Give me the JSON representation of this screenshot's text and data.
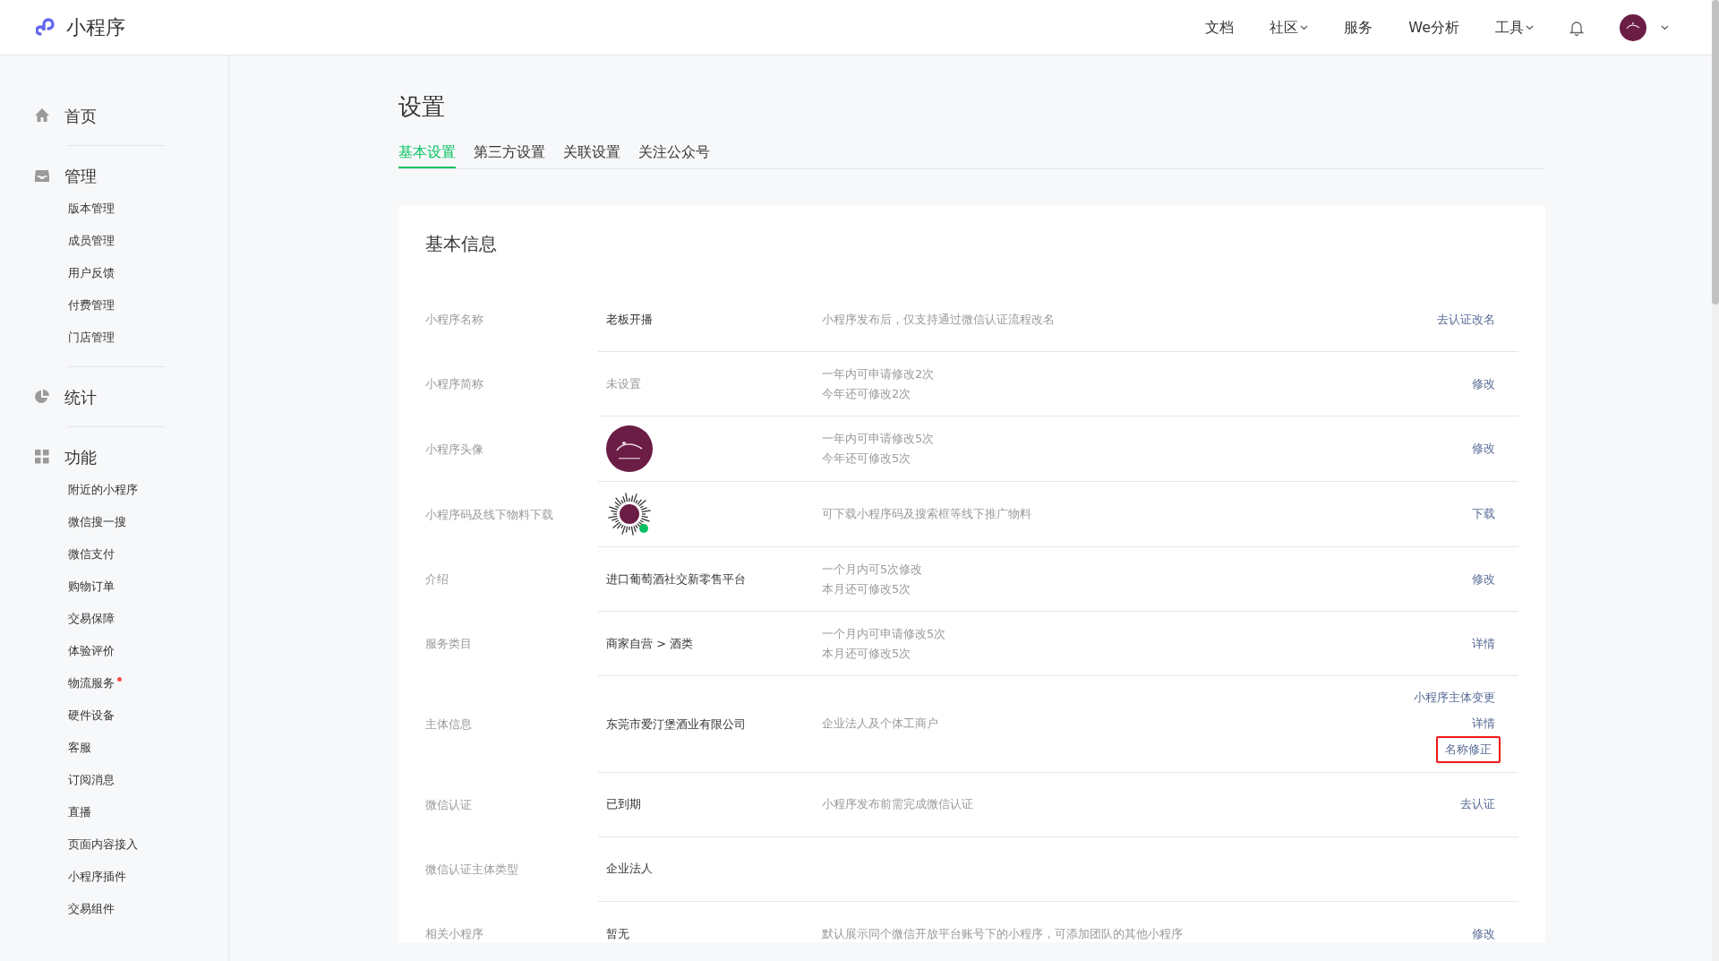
{
  "header": {
    "brand": "小程序",
    "nav": [
      {
        "label": "文档",
        "dropdown": false
      },
      {
        "label": "社区",
        "dropdown": true
      },
      {
        "label": "服务",
        "dropdown": false
      },
      {
        "label": "We分析",
        "dropdown": false
      },
      {
        "label": "工具",
        "dropdown": true
      }
    ]
  },
  "sidebar": {
    "sections": [
      {
        "title": "首页"
      },
      {
        "title": "管理",
        "items": [
          {
            "label": "版本管理",
            "dot": false
          },
          {
            "label": "成员管理",
            "dot": false
          },
          {
            "label": "用户反馈",
            "dot": false
          },
          {
            "label": "付费管理",
            "dot": false
          },
          {
            "label": "门店管理",
            "dot": false
          }
        ]
      },
      {
        "title": "统计"
      },
      {
        "title": "功能",
        "items": [
          {
            "label": "附近的小程序",
            "dot": false
          },
          {
            "label": "微信搜一搜",
            "dot": false
          },
          {
            "label": "微信支付",
            "dot": false
          },
          {
            "label": "购物订单",
            "dot": false
          },
          {
            "label": "交易保障",
            "dot": false
          },
          {
            "label": "体验评价",
            "dot": false
          },
          {
            "label": "物流服务",
            "dot": true
          },
          {
            "label": "硬件设备",
            "dot": false
          },
          {
            "label": "客服",
            "dot": false
          },
          {
            "label": "订阅消息",
            "dot": false
          },
          {
            "label": "直播",
            "dot": false
          },
          {
            "label": "页面内容接入",
            "dot": false
          },
          {
            "label": "小程序插件",
            "dot": false
          },
          {
            "label": "交易组件",
            "dot": false
          }
        ]
      }
    ]
  },
  "page": {
    "title": "设置",
    "tabs": [
      {
        "label": "基本设置",
        "selected": true
      },
      {
        "label": "第三方设置",
        "selected": false
      },
      {
        "label": "关联设置",
        "selected": false
      },
      {
        "label": "关注公众号",
        "selected": false
      }
    ]
  },
  "card": {
    "title": "基本信息",
    "rows": [
      {
        "label": "小程序名称",
        "kind": "text",
        "value": "老板开播",
        "muted": false,
        "notes": [
          "小程序发布后，仅支持通过微信认证流程改名"
        ],
        "actions": [
          {
            "label": "去认证改名",
            "highlighted": false
          }
        ]
      },
      {
        "label": "小程序简称",
        "kind": "text",
        "value": "未设置",
        "muted": true,
        "notes": [
          "一年内可申请修改2次",
          "今年还可修改2次"
        ],
        "actions": [
          {
            "label": "修改",
            "highlighted": false
          }
        ]
      },
      {
        "label": "小程序头像",
        "kind": "avatar",
        "notes": [
          "一年内可申请修改5次",
          "今年还可修改5次"
        ],
        "actions": [
          {
            "label": "修改",
            "highlighted": false
          }
        ]
      },
      {
        "label": "小程序码及线下物料下载",
        "kind": "qrcode",
        "notes": [
          "可下载小程序码及搜索框等线下推广物料"
        ],
        "actions": [
          {
            "label": "下载",
            "highlighted": false
          }
        ]
      },
      {
        "label": "介绍",
        "kind": "text",
        "value": "进口葡萄酒社交新零售平台",
        "muted": false,
        "notes": [
          "一个月内可5次修改",
          "本月还可修改5次"
        ],
        "actions": [
          {
            "label": "修改",
            "highlighted": false
          }
        ]
      },
      {
        "label": "服务类目",
        "kind": "text",
        "value": "商家自营 > 酒类",
        "muted": false,
        "notes": [
          "一个月内可申请修改5次",
          "本月还可修改5次"
        ],
        "actions": [
          {
            "label": "详情",
            "highlighted": false
          }
        ]
      },
      {
        "label": "主体信息",
        "kind": "text",
        "value": "东莞市爱汀堡酒业有限公司",
        "muted": false,
        "notes": [
          "企业法人及个体工商户"
        ],
        "actions": [
          {
            "label": "小程序主体变更",
            "highlighted": false
          },
          {
            "label": "详情",
            "highlighted": false
          },
          {
            "label": "名称修正",
            "highlighted": true
          }
        ]
      },
      {
        "label": "微信认证",
        "kind": "text",
        "value": "已到期",
        "muted": false,
        "notes": [
          "小程序发布前需完成微信认证"
        ],
        "actions": [
          {
            "label": "去认证",
            "highlighted": false
          }
        ]
      },
      {
        "label": "微信认证主体类型",
        "kind": "text",
        "value": "企业法人",
        "muted": false
      },
      {
        "label": "相关小程序",
        "kind": "text",
        "value": "暂无",
        "muted": false,
        "notes": [
          "默认展示同个微信开放平台账号下的小程序，可添加团队的其他小程序"
        ],
        "actions": [
          {
            "label": "修改",
            "highlighted": false
          }
        ]
      }
    ]
  }
}
